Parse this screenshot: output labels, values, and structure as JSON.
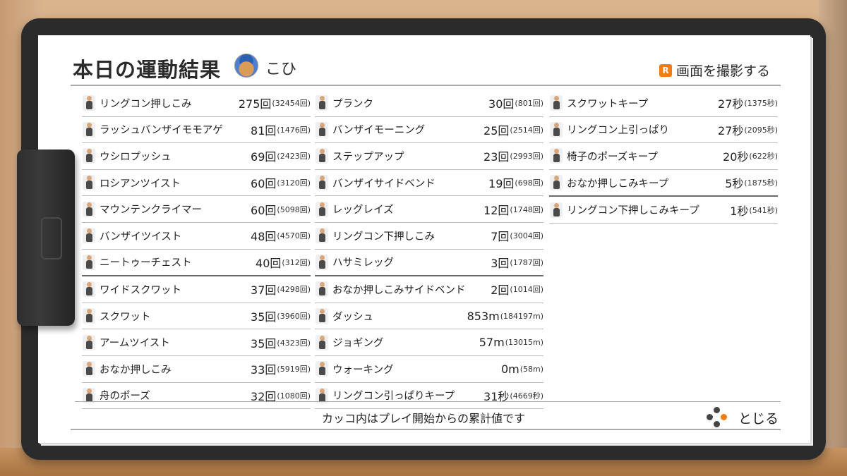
{
  "header": {
    "title": "本日の運動結果",
    "username": "こひ",
    "capture_label": "画面を撮影する",
    "capture_button_letter": "R"
  },
  "columns": [
    [
      {
        "name": "リングコン押しこみ",
        "value": "275回",
        "total": "(32454回)"
      },
      {
        "name": "ラッシュバンザイモモアゲ",
        "value": "81回",
        "total": "(1476回)"
      },
      {
        "name": "ウシロプッシュ",
        "value": "69回",
        "total": "(2423回)"
      },
      {
        "name": "ロシアンツイスト",
        "value": "60回",
        "total": "(3120回)"
      },
      {
        "name": "マウンテンクライマー",
        "value": "60回",
        "total": "(5098回)"
      },
      {
        "name": "バンザイツイスト",
        "value": "48回",
        "total": "(4570回)"
      },
      {
        "name": "ニートゥーチェスト",
        "value": "40回",
        "total": "(312回)"
      },
      {
        "name": "ワイドスクワット",
        "value": "37回",
        "total": "(4298回)"
      },
      {
        "name": "スクワット",
        "value": "35回",
        "total": "(3960回)"
      },
      {
        "name": "アームツイスト",
        "value": "35回",
        "total": "(4323回)"
      },
      {
        "name": "おなか押しこみ",
        "value": "33回",
        "total": "(5919回)"
      },
      {
        "name": "舟のポーズ",
        "value": "32回",
        "total": "(1080回)"
      }
    ],
    [
      {
        "name": "プランク",
        "value": "30回",
        "total": "(801回)"
      },
      {
        "name": "バンザイモーニング",
        "value": "25回",
        "total": "(2514回)"
      },
      {
        "name": "ステップアップ",
        "value": "23回",
        "total": "(2993回)"
      },
      {
        "name": "バンザイサイドベンド",
        "value": "19回",
        "total": "(698回)"
      },
      {
        "name": "レッグレイズ",
        "value": "12回",
        "total": "(1748回)"
      },
      {
        "name": "リングコン下押しこみ",
        "value": "7回",
        "total": "(3004回)"
      },
      {
        "name": "ハサミレッグ",
        "value": "3回",
        "total": "(1787回)"
      },
      {
        "name": "おなか押しこみサイドベンド",
        "value": "2回",
        "total": "(1014回)"
      },
      {
        "name": "ダッシュ",
        "value": "853m",
        "total": "(184197m)"
      },
      {
        "name": "ジョギング",
        "value": "57m",
        "total": "(13015m)"
      },
      {
        "name": "ウォーキング",
        "value": "0m",
        "total": "(58m)"
      },
      {
        "name": "リングコン引っぱりキープ",
        "value": "31秒",
        "total": "(4669秒)"
      }
    ],
    [
      {
        "name": "スクワットキープ",
        "value": "27秒",
        "total": "(1375秒)"
      },
      {
        "name": "リングコン上引っぱり",
        "value": "27秒",
        "total": "(2095秒)"
      },
      {
        "name": "椅子のポーズキープ",
        "value": "20秒",
        "total": "(622秒)"
      },
      {
        "name": "おなか押しこみキープ",
        "value": "5秒",
        "total": "(1875秒)"
      },
      {
        "name": "リングコン下押しこみキープ",
        "value": "1秒",
        "total": "(541秒)"
      }
    ]
  ],
  "footer": {
    "note": "カッコ内はプレイ開始からの累計値です",
    "close_label": "とじる"
  },
  "colors": {
    "accent": "#f07e14",
    "board": "#2b2b2b",
    "paper": "#ffffff"
  }
}
